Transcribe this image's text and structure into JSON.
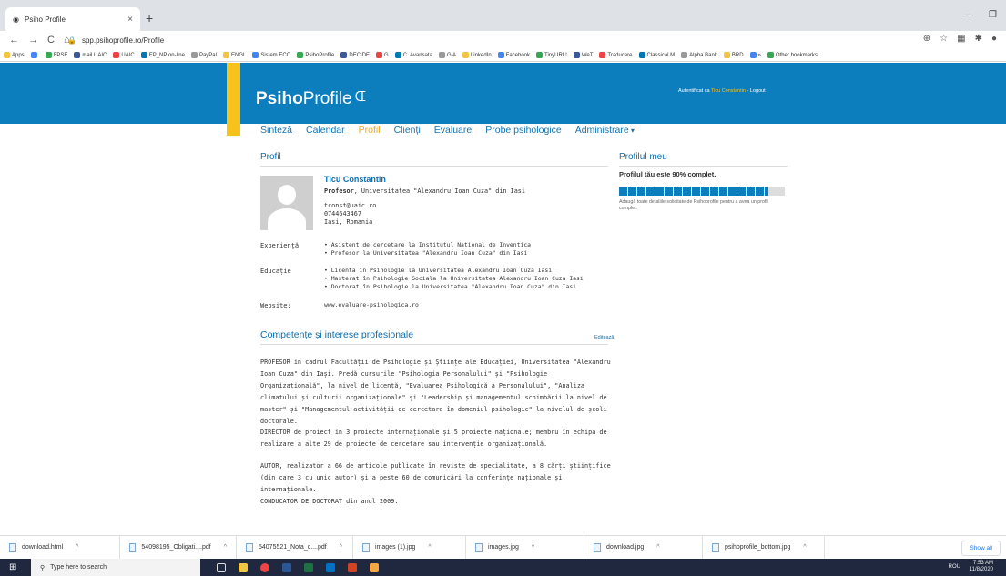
{
  "browser": {
    "tab_title": "Psiho Profile",
    "tab_close": "×",
    "new_tab": "+",
    "url": "spp.psihoprofile.ro/Profile",
    "min": "–",
    "max": "❐",
    "close": "✕",
    "bookmarks": [
      "Apps",
      "",
      "FPSE",
      "mail UAIC",
      "UAIC",
      "EP_NP on-line",
      "PayPal",
      "ENGL",
      "Sistem ECO",
      "PsihoProfile",
      "DECIDE",
      "G",
      "C. Avansata",
      "G A",
      "LinkedIn",
      "Facebook",
      "TinyURL!",
      "WeT",
      "Traducere",
      "Classical M",
      "Alpha Bank",
      "BRD",
      "»",
      "Other bookmarks"
    ]
  },
  "header": {
    "logo_bold": "Psiho",
    "logo_rest": "Profile",
    "auth_prefix": "Autentificat ca ",
    "auth_user": "Ticu Constantin",
    "auth_sep": " - ",
    "logout": "Logout"
  },
  "menu": [
    "Sinteză",
    "Calendar",
    "Profil",
    "Clienți",
    "Evaluare",
    "Probe psihologice",
    "Administrare"
  ],
  "profile": {
    "section_title": "Profil",
    "name": "Ticu Constantin",
    "role_bold": "Profesor",
    "role_rest": ", Universitatea \"Alexandru Ioan Cuza\" din Iasi",
    "email": "tconst@uaic.ro",
    "phone": "0744643467",
    "location": "Iasi, Romania",
    "experience_label": "Experiență",
    "experience": [
      "Asistent de cercetare la Institutul National de Inventica",
      "Profesor la Universitatea \"Alexandru Ioan Cuza\" din Iasi"
    ],
    "education_label": "Educație",
    "education": [
      "Licenta în Psihologie la Universitatea Alexandru Ioan Cuza Iasi",
      "Masterat în Psihologie Sociala la Universitatea Alexandru Ioan Cuza Iasi",
      "Doctorat în Psihologie la Universitatea \"Alexandru Ioan Cuza\" din Iasi"
    ],
    "website_label": "Website:",
    "website": "www.evaluare-psihologica.ro"
  },
  "skills": {
    "title": "Competențe și interese profesionale",
    "edit": "Editează",
    "paragraphs": [
      "PROFESOR în cadrul Facultății de Psihologie și Științe ale Educației, Universitatea \"Alexandru Ioan Cuza\" din Iași. Predă cursurile \"Psihologia Personalului\" și \"Psihologie Organizațională\", la nivel de licență, \"Evaluarea Psihologică a Personalului\", \"Analiza climatului și culturii organizaționale\" și \"Leadership și managementul schimbării la nivel de master\" și \"Managementul activității de cercetare în domeniul psihologic\" la nivelul de școli doctorale.",
      "DIRECTOR de proiect în 3 proiecte internaționale și 5 proiecte naționale; membru în echipa de realizare a alte 29 de proiecte de cercetare sau intervenție organizațională.",
      "AUTOR, realizator a 66 de articole publicate în reviste de specialitate, a 8 cărți științifice (din care 3 cu unic autor) și a peste 60 de comunicări la conferințe naționale și internaționale.",
      "CONDUCATOR DE DOCTORAT din anul 2009."
    ]
  },
  "sidebar": {
    "title": "Profilul meu",
    "completion": "Profilul tău este 90% complet.",
    "progress": 0.9,
    "hint": "Adaugă toate detaliile solicitate de Psihoprofile pentru a avea un profil complet."
  },
  "downloads": {
    "items": [
      "download.html",
      "54098195_Obligati....pdf",
      "54075521_Nota_c....pdf",
      "images (1).jpg",
      "images.jpg",
      "download.jpg",
      "psihoprofile_bottom.jpg"
    ],
    "show_all": "Show all"
  },
  "taskbar": {
    "search": "Type here to search",
    "lang": "ROU",
    "time": "7:53 AM",
    "date": "11/8/2020"
  },
  "colors": {
    "header": "#0c7dbd",
    "accent": "#f8c21c",
    "link": "#0c6fb0",
    "active_menu": "#f3a81d"
  }
}
